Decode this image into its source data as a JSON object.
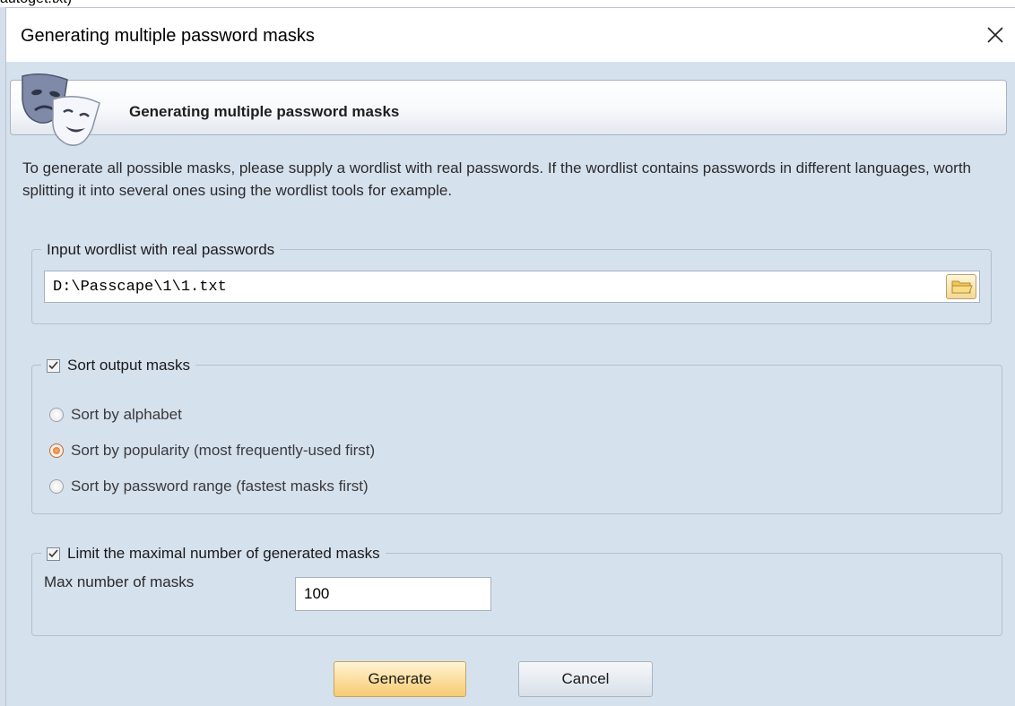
{
  "background_fragment": "autoget.txt)",
  "dialog": {
    "title": "Generating multiple password masks",
    "close_glyph": "✕"
  },
  "banner": {
    "title": "Generating multiple password masks",
    "icon": "theater-masks-icon"
  },
  "description": "To generate all possible masks, please supply a wordlist with real passwords. If the wordlist contains passwords in different languages, worth splitting it into several ones using the wordlist tools for example.",
  "input_group": {
    "legend": "Input wordlist with real passwords",
    "path_value": "D:\\Passcape\\1\\1.txt",
    "browse_icon": "folder-icon"
  },
  "sort_group": {
    "legend": "Sort output masks",
    "checked": true,
    "options": [
      {
        "label": "Sort by alphabet",
        "selected": false
      },
      {
        "label": "Sort by popularity (most frequently-used first)",
        "selected": true
      },
      {
        "label": "Sort by password range (fastest masks first)",
        "selected": false
      }
    ]
  },
  "limit_group": {
    "legend": "Limit the maximal number of generated masks",
    "checked": true,
    "max_label": "Max number of masks",
    "max_value": "100"
  },
  "buttons": {
    "generate": "Generate",
    "cancel": "Cancel"
  },
  "colors": {
    "window_bg": "#d6e1ee",
    "accent": "#f6cc73",
    "radio_selected": "#d8692a"
  }
}
